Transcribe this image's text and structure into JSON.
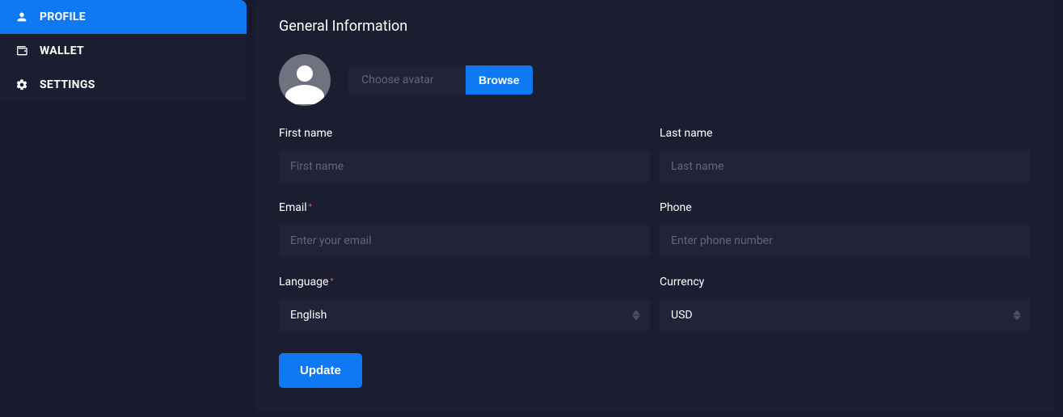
{
  "sidebar": {
    "items": [
      {
        "label": "PROFILE",
        "icon": "person",
        "active": true
      },
      {
        "label": "WALLET",
        "icon": "wallet",
        "active": false
      },
      {
        "label": "SETTINGS",
        "icon": "gear",
        "active": false
      }
    ]
  },
  "card": {
    "title": "General Information",
    "avatar": {
      "choose_label": "Choose avatar",
      "browse_label": "Browse"
    },
    "fields": {
      "first_name": {
        "label": "First name",
        "placeholder": "First name",
        "value": "",
        "required": false
      },
      "last_name": {
        "label": "Last name",
        "placeholder": "Last name",
        "value": "",
        "required": false
      },
      "email": {
        "label": "Email",
        "placeholder": "Enter your email",
        "value": "",
        "required": true
      },
      "phone": {
        "label": "Phone",
        "placeholder": "Enter phone number",
        "value": "",
        "required": false
      },
      "language": {
        "label": "Language",
        "value": "English",
        "required": true
      },
      "currency": {
        "label": "Currency",
        "value": "USD",
        "required": false
      }
    },
    "submit_label": "Update"
  },
  "colors": {
    "accent": "#0f79f3",
    "panel": "#1b1e31",
    "input": "#212438",
    "bg": "#17192c"
  }
}
